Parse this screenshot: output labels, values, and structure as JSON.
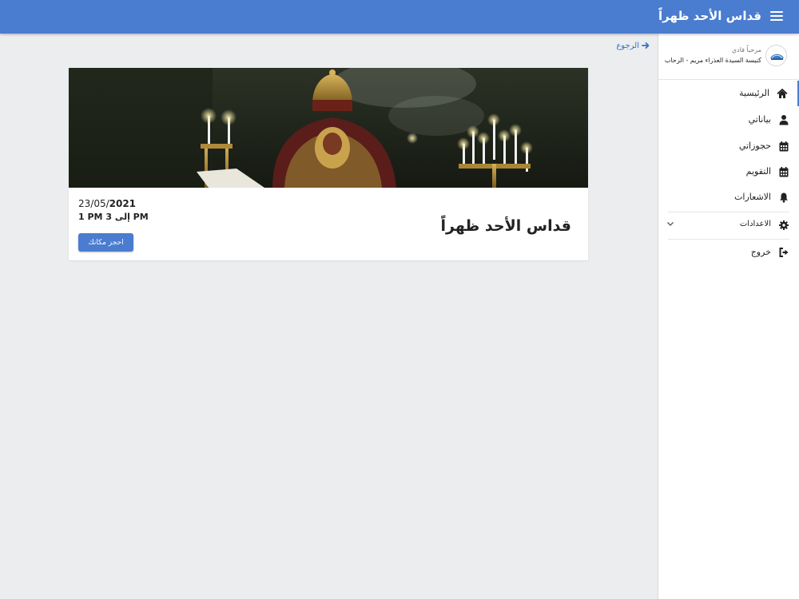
{
  "header": {
    "title": "قداس الأحد ظهراً",
    "menu_icon": "hamburger-icon"
  },
  "sidebar": {
    "profile": {
      "greeting": "مرحباً فادي",
      "church": "كنيسة السيدة العذراء مريم - الرحاب",
      "avatar_icon": "church-logo-icon"
    },
    "items": [
      {
        "label": "الرئيسية",
        "icon": "home-icon",
        "active": true
      },
      {
        "label": "بياناتي",
        "icon": "user-icon"
      },
      {
        "label": "حجوزاتي",
        "icon": "calendar-icon"
      },
      {
        "label": "التقويم",
        "icon": "calendar-icon"
      },
      {
        "label": "الاشعارات",
        "icon": "bell-icon"
      },
      {
        "label": "الاعدادات",
        "icon": "gear-icon",
        "expandable": true
      },
      {
        "label": "خروج",
        "icon": "logout-icon"
      }
    ]
  },
  "main": {
    "back_label": "الرجوع",
    "event": {
      "title": "قداس الأحد ظهراً",
      "date_prefix": "23/05/",
      "date_year": "2021",
      "time": "1 PM إلى 3 PM",
      "book_label": "احجز مكانك"
    }
  },
  "colors": {
    "accent": "#4a7ccf",
    "background": "#ebedef"
  }
}
